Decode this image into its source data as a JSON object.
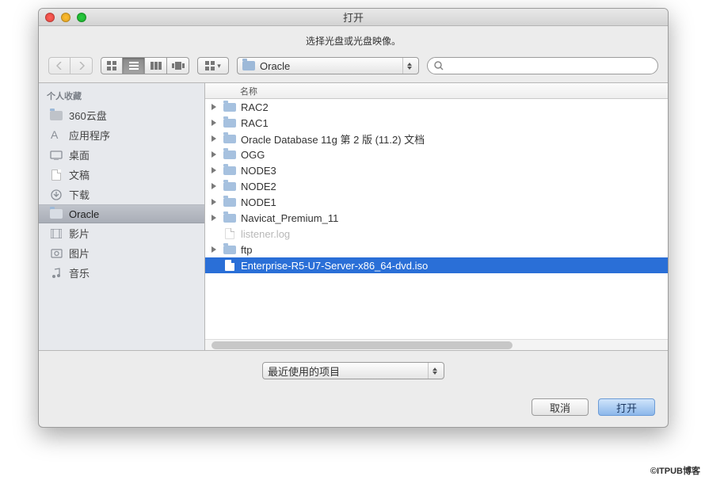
{
  "window": {
    "title": "打开"
  },
  "instruction": "选择光盘或光盘映像。",
  "toolbar": {
    "path_popup": {
      "label": "Oracle"
    },
    "search": {
      "placeholder": ""
    }
  },
  "sidebar": {
    "section_favorites": "个人收藏",
    "items": [
      {
        "label": "360云盘",
        "icon": "folder"
      },
      {
        "label": "应用程序",
        "icon": "apps"
      },
      {
        "label": "桌面",
        "icon": "desktop"
      },
      {
        "label": "文稿",
        "icon": "documents"
      },
      {
        "label": "下载",
        "icon": "downloads"
      },
      {
        "label": "Oracle",
        "icon": "folder",
        "selected": true
      },
      {
        "label": "影片",
        "icon": "movies"
      },
      {
        "label": "图片",
        "icon": "pictures"
      },
      {
        "label": "音乐",
        "icon": "music"
      }
    ]
  },
  "filelist": {
    "header_name": "名称",
    "rows": [
      {
        "label": "RAC2",
        "kind": "folder"
      },
      {
        "label": "RAC1",
        "kind": "folder"
      },
      {
        "label": "Oracle Database 11g 第 2 版 (11.2) 文档",
        "kind": "folder"
      },
      {
        "label": "OGG",
        "kind": "folder"
      },
      {
        "label": "NODE3",
        "kind": "folder"
      },
      {
        "label": "NODE2",
        "kind": "folder"
      },
      {
        "label": "NODE1",
        "kind": "folder"
      },
      {
        "label": "Navicat_Premium_11",
        "kind": "folder"
      },
      {
        "label": "listener.log",
        "kind": "file",
        "dim": true
      },
      {
        "label": "ftp",
        "kind": "folder"
      },
      {
        "label": "Enterprise-R5-U7-Server-x86_64-dvd.iso",
        "kind": "file",
        "selected": true
      }
    ]
  },
  "footer": {
    "recent_label": "最近使用的项目",
    "cancel": "取消",
    "open": "打开"
  },
  "watermark": "©ITPUB博客"
}
